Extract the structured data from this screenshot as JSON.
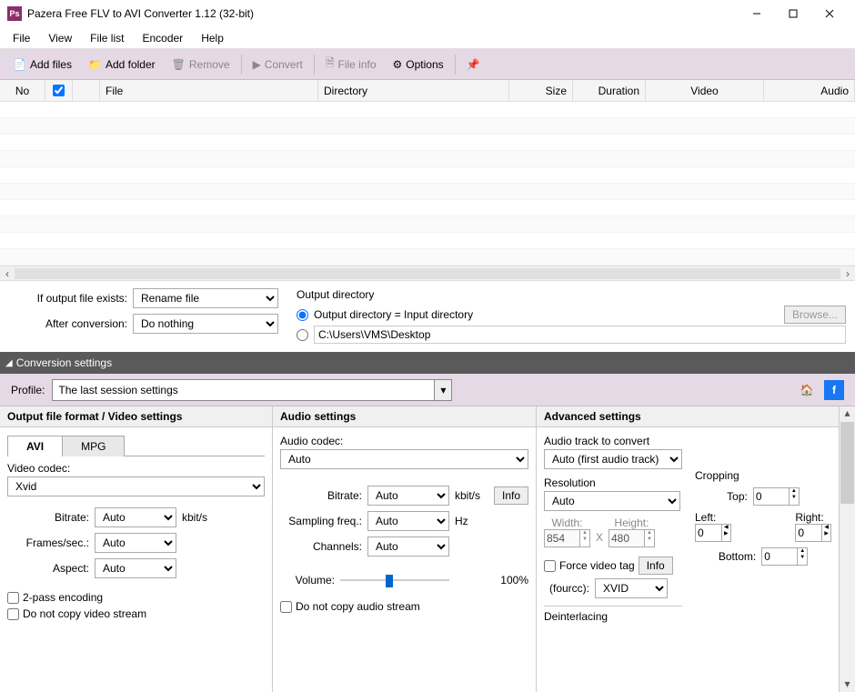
{
  "window": {
    "title": "Pazera Free FLV to AVI Converter 1.12 (32-bit)",
    "app_short": "Ps"
  },
  "menubar": [
    "File",
    "View",
    "File list",
    "Encoder",
    "Help"
  ],
  "toolbar": {
    "add_files": "Add files",
    "add_folder": "Add folder",
    "remove": "Remove",
    "convert": "Convert",
    "file_info": "File info",
    "options": "Options"
  },
  "file_list": {
    "columns": [
      "No",
      "",
      "File",
      "Directory",
      "Size",
      "Duration",
      "Video",
      "Audio"
    ]
  },
  "mid": {
    "if_exists_label": "If output file exists:",
    "if_exists_value": "Rename file",
    "after_conv_label": "After conversion:",
    "after_conv_value": "Do nothing",
    "output_dir_label": "Output directory",
    "output_eq_input": "Output directory = Input directory",
    "custom_path": "C:\\Users\\VMS\\Desktop",
    "browse": "Browse..."
  },
  "conv_header": "Conversion settings",
  "profile": {
    "label": "Profile:",
    "value": "The last session settings"
  },
  "video": {
    "panel_title": "Output file format / Video settings",
    "tab_avi": "AVI",
    "tab_mpg": "MPG",
    "codec_label": "Video codec:",
    "codec_value": "Xvid",
    "bitrate_label": "Bitrate:",
    "bitrate_value": "Auto",
    "bitrate_unit": "kbit/s",
    "fps_label": "Frames/sec.:",
    "fps_value": "Auto",
    "aspect_label": "Aspect:",
    "aspect_value": "Auto",
    "twopass": "2-pass encoding",
    "nocopy": "Do not copy video stream"
  },
  "audio": {
    "panel_title": "Audio settings",
    "codec_label": "Audio codec:",
    "codec_value": "Auto",
    "bitrate_label": "Bitrate:",
    "bitrate_value": "Auto",
    "bitrate_unit": "kbit/s",
    "info": "Info",
    "sample_label": "Sampling freq.:",
    "sample_value": "Auto",
    "sample_unit": "Hz",
    "channels_label": "Channels:",
    "channels_value": "Auto",
    "volume_label": "Volume:",
    "volume_value": "100%",
    "nocopy": "Do not copy audio stream"
  },
  "advanced": {
    "panel_title": "Advanced settings",
    "track_label": "Audio track to convert",
    "track_value": "Auto (first audio track)",
    "res_label": "Resolution",
    "res_value": "Auto",
    "width_label": "Width:",
    "width_value": "854",
    "height_label": "Height:",
    "height_value": "480",
    "crop_label": "Cropping",
    "top_label": "Top:",
    "top_value": "0",
    "left_label": "Left:",
    "left_value": "0",
    "right_label": "Right:",
    "right_value": "0",
    "bottom_label": "Bottom:",
    "bottom_value": "0",
    "force_tag": "Force video tag",
    "info": "Info",
    "fourcc_label": "(fourcc):",
    "fourcc_value": "XVID",
    "x": "X",
    "deint_label": "Deinterlacing"
  }
}
